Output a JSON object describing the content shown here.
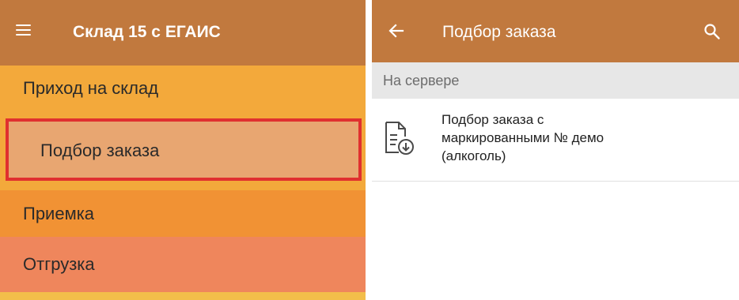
{
  "left": {
    "app_title": "Склад 15 с ЕГАИС",
    "menu_icon": "hamburger-menu-icon",
    "menu_items": [
      {
        "label": "Приход на склад",
        "color": "#f3a93b"
      },
      {
        "label": "Подбор заказа",
        "color": "#e8a671",
        "highlighted": true,
        "highlight_color": "#e0302f"
      },
      {
        "label": "Приемка",
        "color": "#f19234"
      },
      {
        "label": "Отгрузка",
        "color": "#ef865c"
      }
    ],
    "toolbar_color": "#c1793e"
  },
  "right": {
    "title": "Подбор заказа",
    "back_icon": "arrow-left-icon",
    "search_icon": "search-icon",
    "section_header": "На сервере",
    "documents": [
      {
        "title": "Подбор заказа с\nмаркированными № демо\n(алкоголь)",
        "icon": "document-download-icon"
      }
    ],
    "toolbar_color": "#c1793e"
  }
}
